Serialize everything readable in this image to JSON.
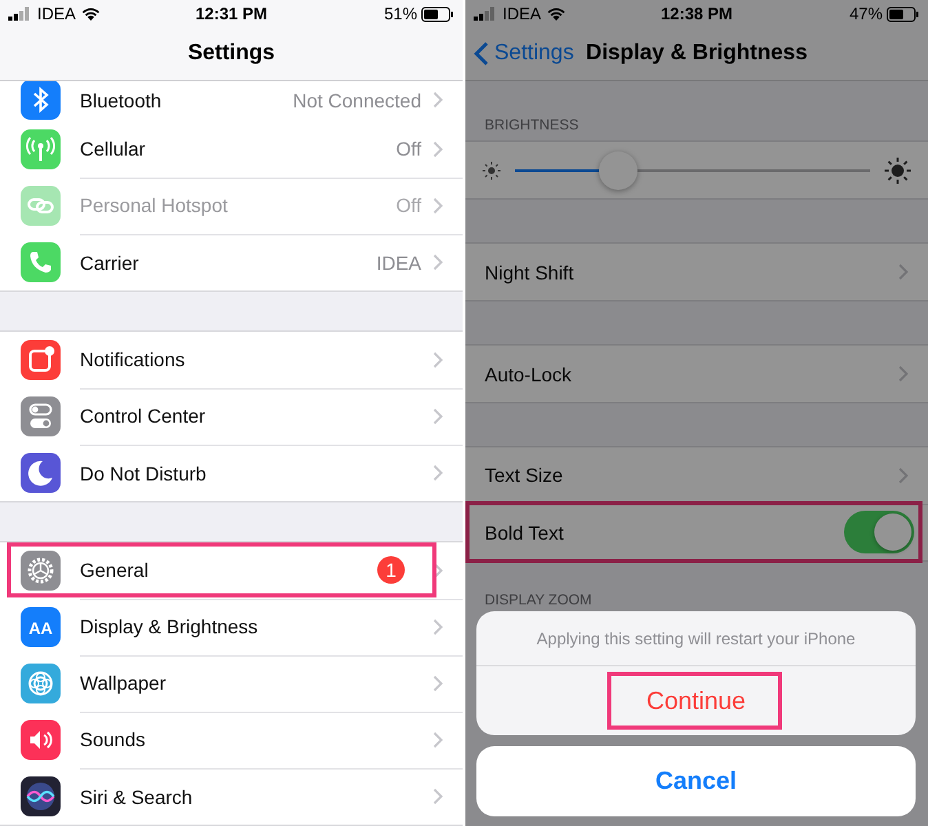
{
  "left_screen": {
    "status_bar": {
      "carrier": "IDEA",
      "time": "12:31 PM",
      "battery": "51%"
    },
    "nav_bar": {
      "title": "Settings"
    },
    "groups": [
      {
        "rows": [
          {
            "label": "Bluetooth",
            "value": "Not Connected",
            "color": "#147efb",
            "disabled": false,
            "highlighted": false
          },
          {
            "label": "Cellular",
            "value": "Off",
            "color": "#4cd964",
            "disabled": false,
            "highlighted": false
          },
          {
            "label": "Personal Hotspot",
            "value": "Off",
            "color": "#a6e6b2",
            "disabled": true,
            "highlighted": false
          },
          {
            "label": "Carrier",
            "value": "IDEA",
            "color": "#4cd964",
            "disabled": false,
            "highlighted": false
          }
        ]
      },
      {
        "rows": [
          {
            "label": "Notifications",
            "color": "#fc3d39",
            "disabled": false,
            "highlighted": false
          },
          {
            "label": "Control Center",
            "color": "#8e8e93",
            "disabled": false,
            "highlighted": false
          },
          {
            "label": "Do Not Disturb",
            "color": "#5856d6",
            "disabled": false,
            "highlighted": false
          }
        ]
      },
      {
        "rows": [
          {
            "label": "General",
            "badge": "1",
            "color": "#8e8e93",
            "disabled": false,
            "highlighted": true
          },
          {
            "label": "Display & Brightness",
            "icon_label": "AA",
            "color": "#147efb",
            "disabled": false,
            "highlighted": false
          },
          {
            "label": "Wallpaper",
            "color": "#34aadc",
            "disabled": false,
            "highlighted": false
          },
          {
            "label": "Sounds",
            "color": "#fc3158",
            "disabled": false,
            "highlighted": false
          },
          {
            "label": "Siri & Search",
            "color": "#222233",
            "disabled": false,
            "highlighted": false
          }
        ]
      }
    ]
  },
  "right_screen": {
    "status_bar": {
      "carrier": "IDEA",
      "time": "12:38 PM",
      "battery": "47%"
    },
    "nav_bar": {
      "back": "Settings",
      "title": "Display & Brightness"
    },
    "dimmed": true,
    "sections": [
      {
        "header": "BRIGHTNESS",
        "rows": [
          {
            "kind": "slider",
            "level": 0.29
          }
        ]
      },
      {
        "rows": [
          {
            "kind": "link",
            "label": "Night Shift",
            "highlighted": false
          }
        ]
      },
      {
        "rows": [
          {
            "kind": "link",
            "label": "Auto-Lock",
            "highlighted": false
          }
        ]
      },
      {
        "rows": [
          {
            "kind": "link",
            "label": "Text Size",
            "highlighted": false
          },
          {
            "kind": "toggle",
            "label": "Bold Text",
            "on": true,
            "highlighted": true
          }
        ]
      },
      {
        "header": "DISPLAY ZOOM"
      }
    ],
    "action_sheet": {
      "message": "Applying this setting will restart your iPhone",
      "actions": [
        {
          "label": "Continue",
          "kind": "destructive",
          "highlighted": true
        }
      ],
      "cancel": "Cancel"
    }
  }
}
